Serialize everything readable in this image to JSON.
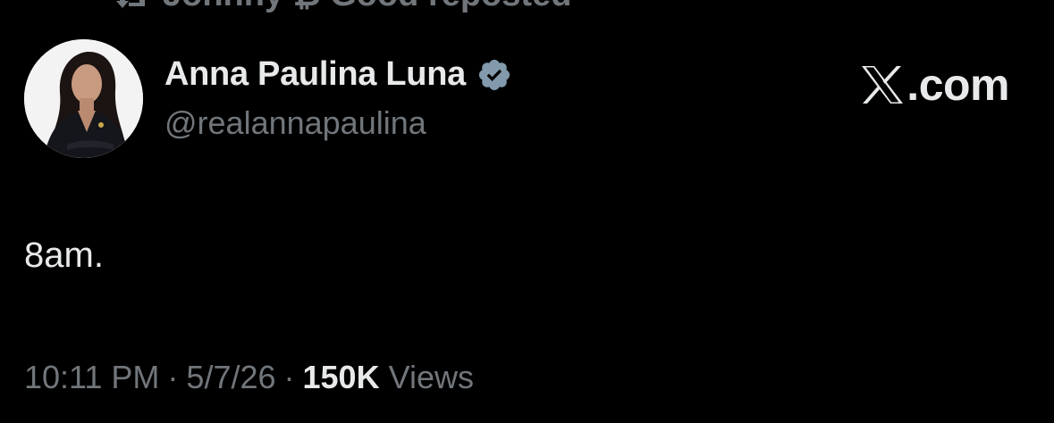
{
  "repost": {
    "text": "Johnny ₿ Good reposted",
    "icon": "repost-icon"
  },
  "author": {
    "display_name": "Anna Paulina Luna",
    "handle": "@realannapaulina",
    "verified_icon": "verified-badge-icon",
    "verified_color": "#829aab",
    "avatar_icon": "avatar-photo"
  },
  "brand": {
    "text": ".com",
    "logo_icon": "x-logo-icon"
  },
  "tweet": {
    "text": "8am."
  },
  "meta": {
    "time": "10:11 PM",
    "separator": "·",
    "date": "5/7/26",
    "views_count": "150K",
    "views_label": "Views"
  },
  "colors": {
    "background": "#000000",
    "primary_text": "#e7e9ea",
    "secondary_text": "#71767b"
  }
}
